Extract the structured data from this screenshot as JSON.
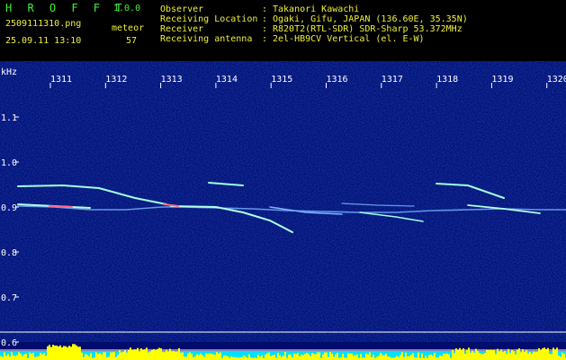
{
  "header": {
    "app_name": "H R O F F T",
    "version": "1.0.0",
    "file_name": "2509111310.png",
    "date_time": "25.09.11 13:10",
    "meteor_label": "meteor",
    "meteor_count": "57",
    "info": [
      {
        "label": "Observer",
        "value": "Takanori Kawachi"
      },
      {
        "label": "Receiving Location",
        "value": "Ogaki, Gifu, JAPAN (136.60E, 35.35N)"
      },
      {
        "label": "Receiver",
        "value": "R820T2(RTL-SDR) SDR-Sharp 53.372MHz"
      },
      {
        "label": "Receiving antenna",
        "value": "2el-HB9CV Vertical (el. E-W)"
      }
    ]
  },
  "spectrogram": {
    "y_unit": "kHz",
    "y_ticks": [
      {
        "value": 1.1,
        "label": "1.1"
      },
      {
        "value": 1.0,
        "label": "1.0"
      },
      {
        "value": 0.9,
        "label": "0.9"
      },
      {
        "value": 0.8,
        "label": "0.8"
      },
      {
        "value": 0.7,
        "label": "0.7"
      },
      {
        "value": 0.6,
        "label": "0.6"
      }
    ],
    "y_range": [
      0.6,
      1.2
    ],
    "x_range": [
      1310.6,
      1320.3
    ],
    "x_ticks": [
      "1311",
      "1312",
      "1313",
      "1314",
      "1315",
      "1316",
      "1317",
      "1318",
      "1319",
      "1320"
    ],
    "colors": {
      "background": "#000c6e",
      "trace": "#9fffe0",
      "grid": "#ffffff",
      "label": "#ffffff",
      "bar_yellow": "#ffff00",
      "bar_cyan": "#00e0ff"
    }
  }
}
